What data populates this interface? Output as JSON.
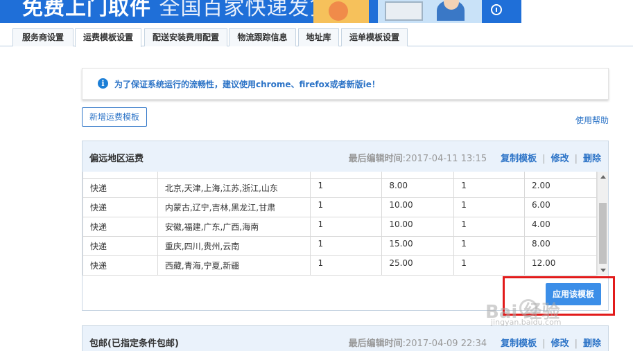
{
  "banner": {
    "text_main": "免费上门取件",
    "text_sub": "全国百家快递发货",
    "colors": {
      "bg": "#1f6fd8"
    }
  },
  "tabs": [
    {
      "label": "服务商设置",
      "active": false
    },
    {
      "label": "运费模板设置",
      "active": true
    },
    {
      "label": "配送安装费用配置",
      "active": false
    },
    {
      "label": "物流跟踪信息",
      "active": false
    },
    {
      "label": "地址库",
      "active": false
    },
    {
      "label": "运单模板设置",
      "active": false
    }
  ],
  "notice": {
    "icon": "info-icon",
    "text": "为了保证系统运行的流畅性，建议使用chrome、firefox或者新版ie！"
  },
  "toolbar": {
    "add_label": "新增运费模板",
    "help_label": "使用帮助"
  },
  "panel1": {
    "title": "偏远地区运费",
    "last_edit_label": "最后编辑时间",
    "last_edit_time": ":2017-04-11 13:15",
    "copy_label": "复制模板",
    "edit_label": "修改",
    "delete_label": "删除",
    "rows": [
      {
        "method": "快递",
        "regions": "北京,天津,上海,江苏,浙江,山东",
        "first_qty": "1",
        "first_fee": "8.00",
        "extra_qty": "1",
        "extra_fee": "2.00"
      },
      {
        "method": "快递",
        "regions": "内蒙古,辽宁,吉林,黑龙江,甘肃",
        "first_qty": "1",
        "first_fee": "10.00",
        "extra_qty": "1",
        "extra_fee": "6.00"
      },
      {
        "method": "快递",
        "regions": "安徽,福建,广东,广西,海南",
        "first_qty": "1",
        "first_fee": "10.00",
        "extra_qty": "1",
        "extra_fee": "4.00"
      },
      {
        "method": "快递",
        "regions": "重庆,四川,贵州,云南",
        "first_qty": "1",
        "first_fee": "15.00",
        "extra_qty": "1",
        "extra_fee": "8.00"
      },
      {
        "method": "快递",
        "regions": "西藏,青海,宁夏,新疆",
        "first_qty": "1",
        "first_fee": "25.00",
        "extra_qty": "1",
        "extra_fee": "12.00"
      }
    ],
    "apply_label": "应用该模板"
  },
  "panel2": {
    "title": "包邮(已指定条件包邮)",
    "last_edit_label": "最后编辑时间",
    "last_edit_time": ":2017-04-09 22:34",
    "copy_label": "复制模板",
    "edit_label": "修改",
    "delete_label": "删除"
  },
  "watermark": {
    "brand": "Bai  经验",
    "site": "jingyan.baidu.com"
  },
  "colors": {
    "accent": "#2d74c7",
    "apply_button": "#3b8ee8",
    "highlight": "#e21b1b",
    "panel_header": "#eaf2fb"
  }
}
